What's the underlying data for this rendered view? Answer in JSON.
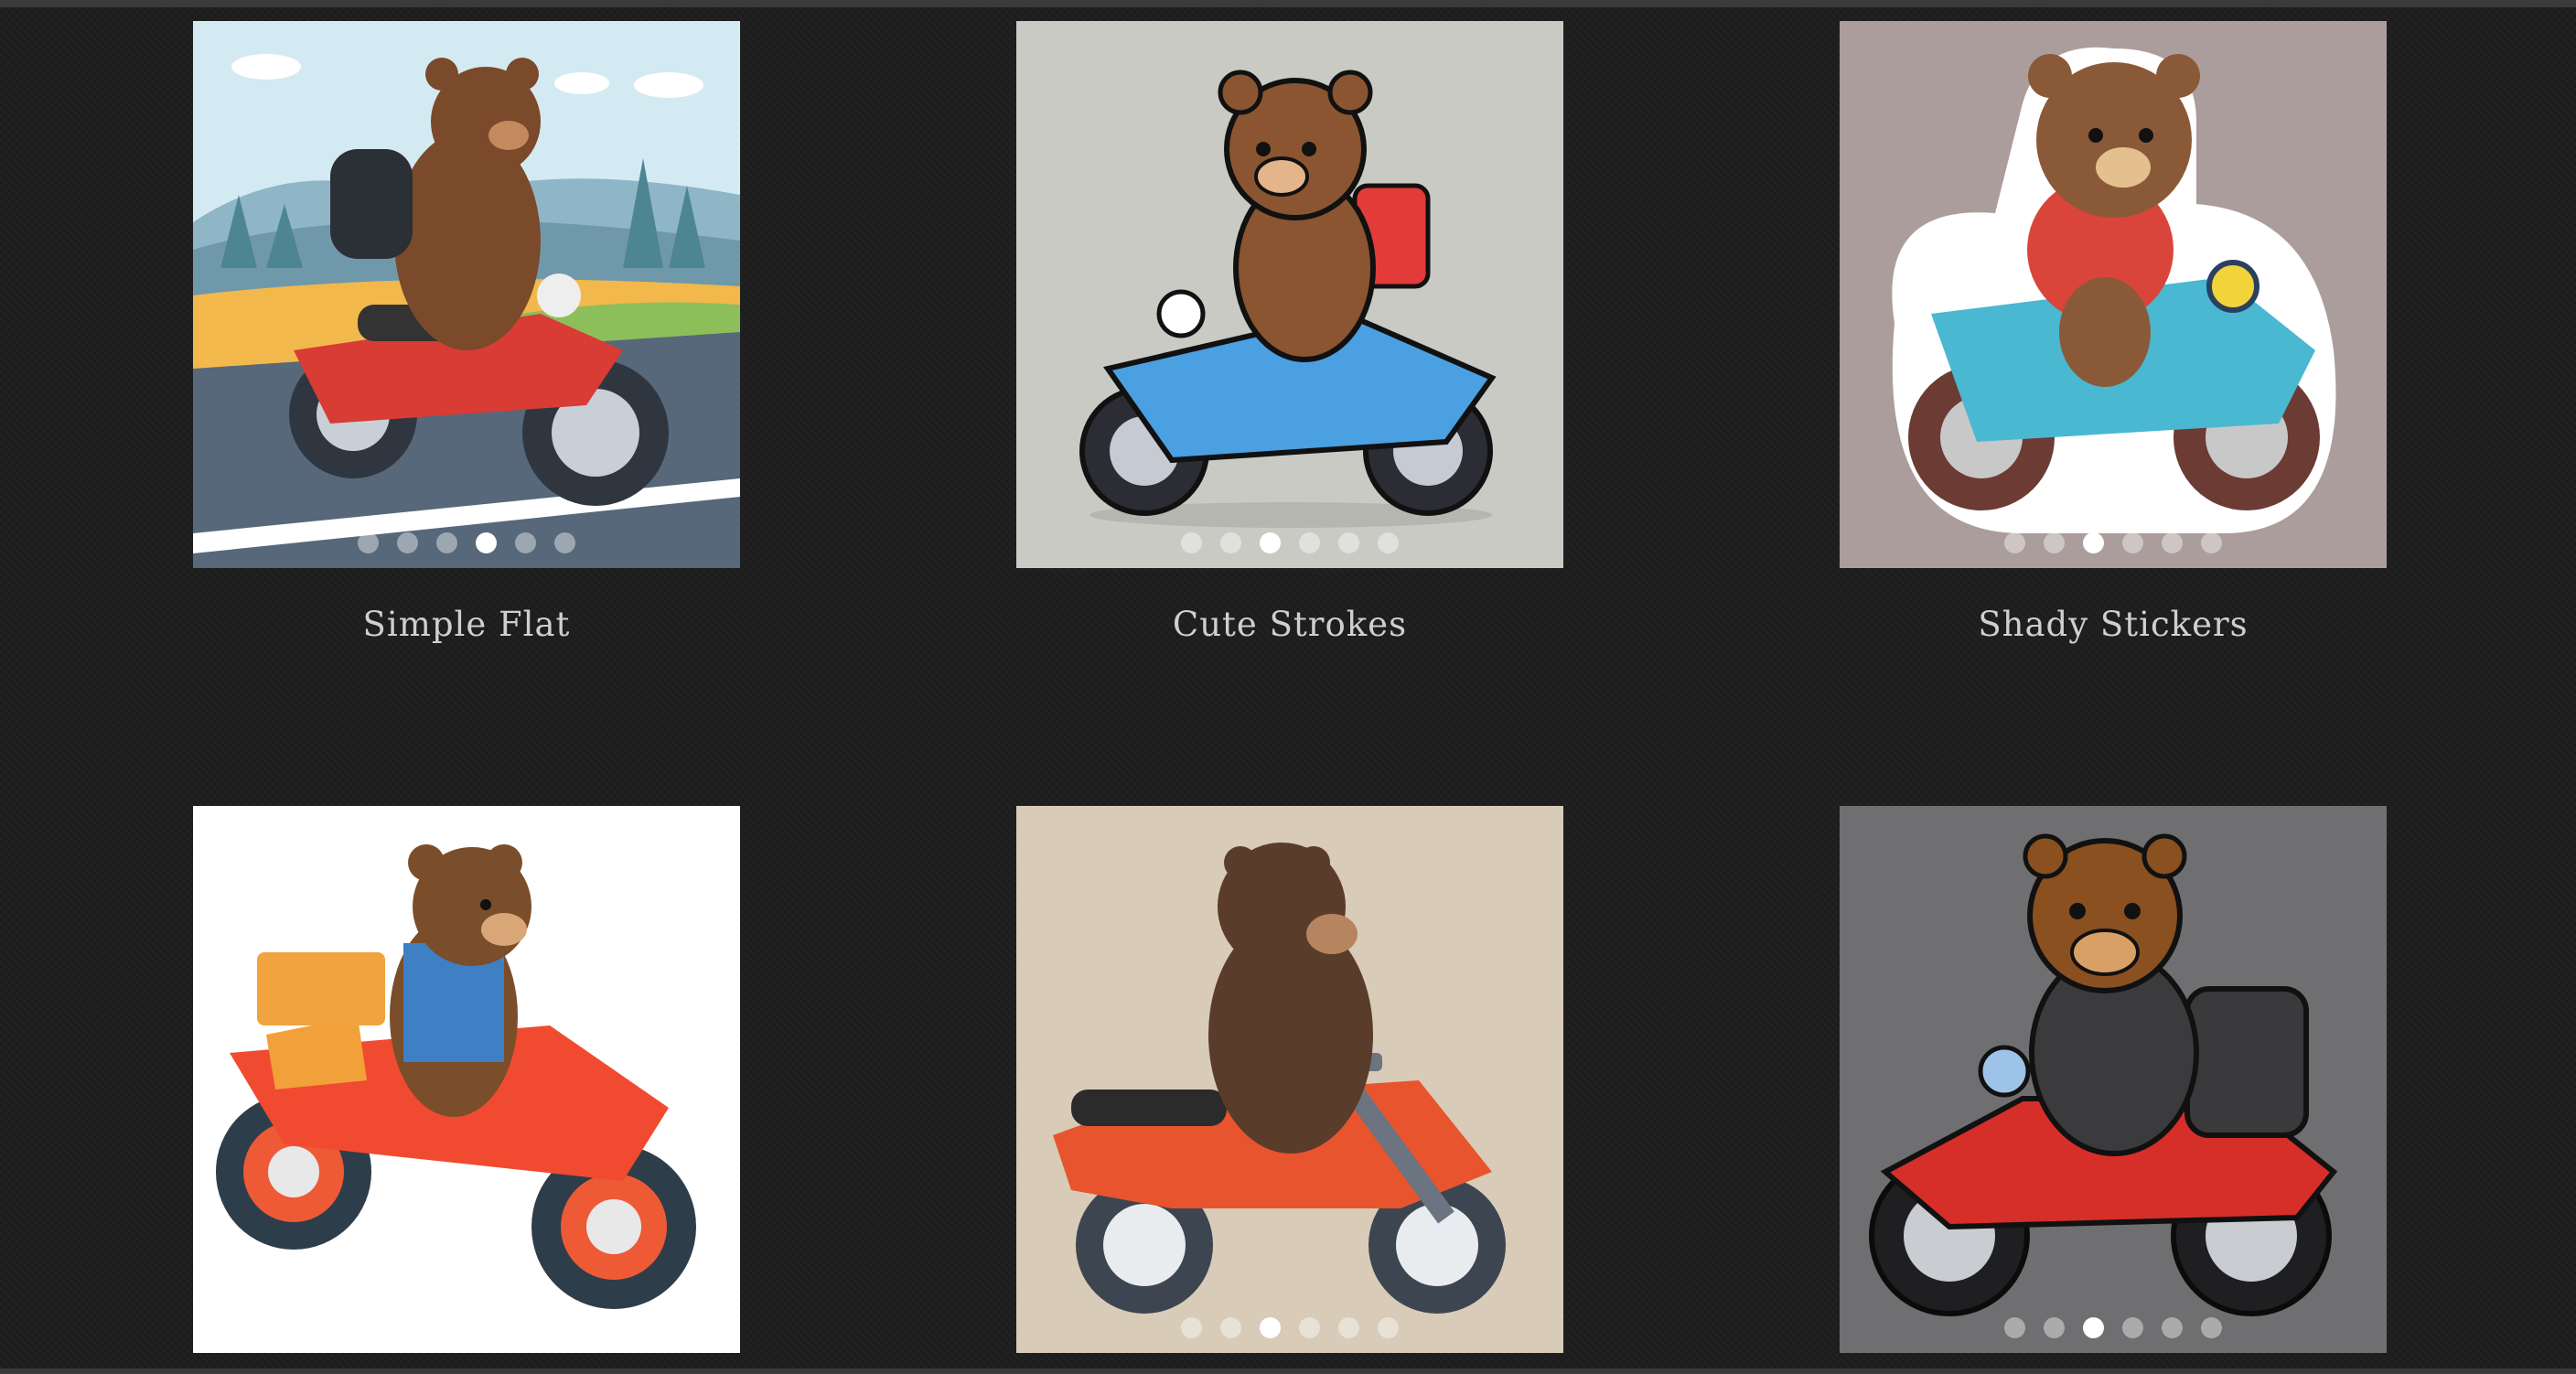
{
  "gallery": {
    "items": [
      {
        "caption": "Simple Flat",
        "slides": 6,
        "active_slide": 4,
        "theme": {
          "bg": "#cfe6f0",
          "bike": "#d93b35",
          "bear": "#7a4a2a"
        }
      },
      {
        "caption": "Cute Strokes",
        "slides": 6,
        "active_slide": 3,
        "theme": {
          "bg": "#c9c9c4",
          "bike": "#4aa0e0",
          "bear": "#8a5530"
        }
      },
      {
        "caption": "Shady Stickers",
        "slides": 6,
        "active_slide": 3,
        "theme": {
          "bg": "#a89a98",
          "bike": "#49b8d0",
          "bear": "#8a5a38"
        }
      },
      {
        "caption": "",
        "slides": 0,
        "active_slide": 0,
        "theme": {
          "bg": "#ffffff",
          "bike": "#f04b30",
          "bear": "#7a4e2a"
        }
      },
      {
        "caption": "",
        "slides": 6,
        "active_slide": 3,
        "theme": {
          "bg": "#d9ccb8",
          "bike": "#e8542e",
          "bear": "#5a3c2a"
        }
      },
      {
        "caption": "",
        "slides": 6,
        "active_slide": 3,
        "theme": {
          "bg": "#6e6e70",
          "bike": "#d62f2a",
          "bear": "#8a5020"
        }
      }
    ]
  }
}
